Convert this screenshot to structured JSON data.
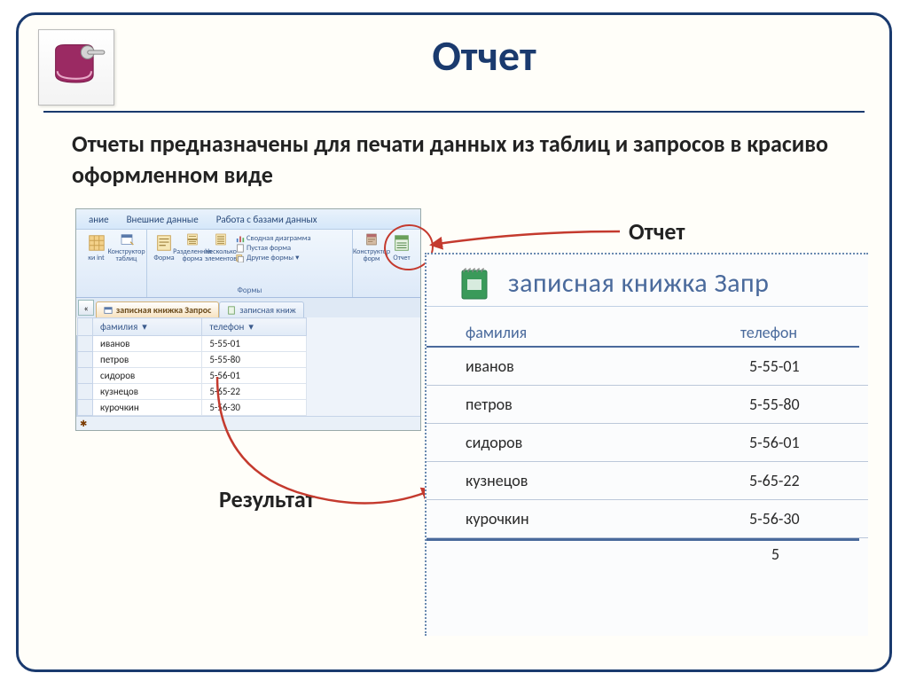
{
  "slide": {
    "title": "Отчет",
    "description": "Отчеты предназначены для печати данных из таблиц и запросов в красиво оформленном виде",
    "callout_report": "Отчет",
    "callout_result": "Результат"
  },
  "ribbon": {
    "tabs": {
      "t1": "ание",
      "t2": "Внешние данные",
      "t3": "Работа с базами данных"
    },
    "groups": {
      "g1": {
        "item1": "ки\nint",
        "item2": "Конструктор\nтаблиц",
        "label": ""
      },
      "g2": {
        "item1": "Форма",
        "item2": "Разделенная\nформа",
        "item3": "Несколько\nэлементов",
        "sub1": "Сводная диаграмма",
        "sub2": "Пустая форма",
        "sub3": "Другие формы",
        "label": "Формы"
      },
      "g3": {
        "item1": "Конструктор\nформ",
        "item2": "Отчет"
      }
    }
  },
  "query_tabs": {
    "left_chevron": "«",
    "active": "записная книжка Запрос",
    "inactive": "записная книж"
  },
  "table": {
    "col1": "фамилия",
    "col2": "телефон",
    "rows": [
      {
        "c1": "иванов",
        "c2": "5-55-01"
      },
      {
        "c1": "петров",
        "c2": "5-55-80"
      },
      {
        "c1": "сидоров",
        "c2": "5-56-01"
      },
      {
        "c1": "кузнецов",
        "c2": "5-65-22"
      },
      {
        "c1": "курочкин",
        "c2": "5-56-30"
      }
    ],
    "footer_star": "✱"
  },
  "report": {
    "title": "записная книжка Запр",
    "col1": "фамилия",
    "col2": "телефон",
    "rows": [
      {
        "c1": "иванов",
        "c2": "5-55-01"
      },
      {
        "c1": "петров",
        "c2": "5-55-80"
      },
      {
        "c1": "сидоров",
        "c2": "5-56-01"
      },
      {
        "c1": "кузнецов",
        "c2": "5-65-22"
      },
      {
        "c1": "курочкин",
        "c2": "5-56-30"
      }
    ],
    "footer_count": "5"
  }
}
